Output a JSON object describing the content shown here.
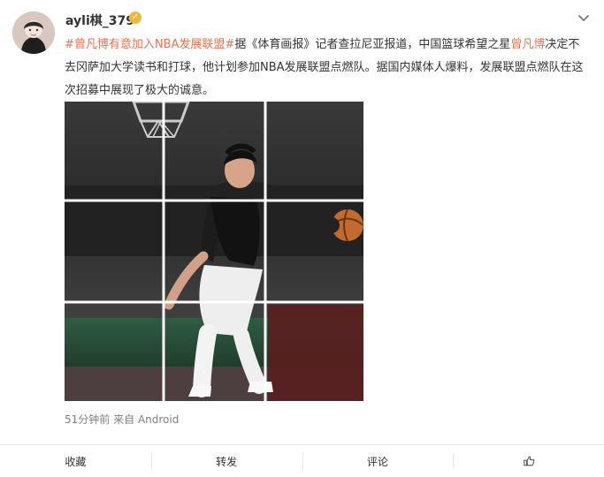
{
  "user": {
    "name": "ayli棋_379",
    "verified_icon": "verified-badge-icon"
  },
  "post": {
    "hashtag1": "#曾凡博有意加入NBA发展联盟#",
    "seg1": "据《体育画报》记者查拉尼亚报道，中国篮球希望之星",
    "mention": "曾凡博",
    "seg2": "决定不去冈萨加大学读书和打球，他计划参加NBA发展联盟点燃队。据国内媒体人爆料，发展联盟点燃队在这次招募中展现了极大的诚意。"
  },
  "meta": {
    "time": "51分钟前",
    "source_prefix": "来自",
    "source": "Android"
  },
  "actions": {
    "favorite": "收藏",
    "repost": "转发",
    "comment": "评论",
    "like_icon": "thumbs-up-icon"
  },
  "colors": {
    "hashtag": "#eb7350",
    "verified": "#f0b83a"
  }
}
